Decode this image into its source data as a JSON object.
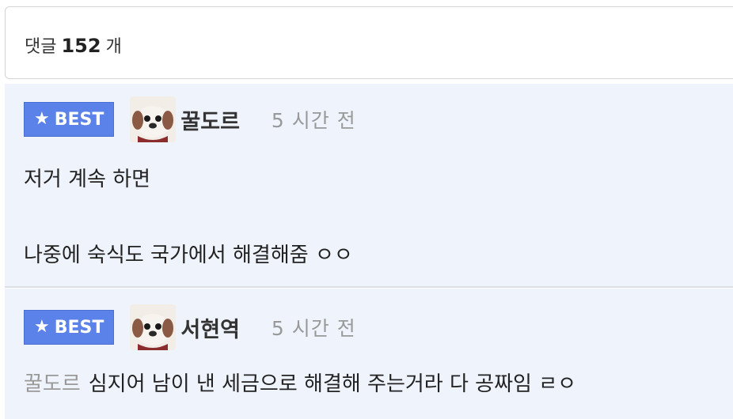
{
  "header": {
    "label_prefix": "댓글",
    "count": "152",
    "label_suffix": "개"
  },
  "comments": [
    {
      "badge": "BEST",
      "nickname": "꿀도르",
      "time": "5 시간 전",
      "lines": [
        "저거 계속 하면",
        "나중에 숙식도 국가에서 해결해줌 ㅇㅇ"
      ]
    },
    {
      "badge": "BEST",
      "nickname": "서현역",
      "time": "5 시간 전",
      "mention": "꿀도르",
      "lines": [
        "심지어 남이 낸 세금으로 해결해 주는거라 다 공짜임 ㄹㅇ"
      ]
    }
  ],
  "colors": {
    "badge": "#5b82e8",
    "comment_bg": "#eff3fc",
    "muted": "#999999"
  },
  "icons": {
    "badge": "star-icon",
    "avatar": "dog-avatar-icon"
  }
}
